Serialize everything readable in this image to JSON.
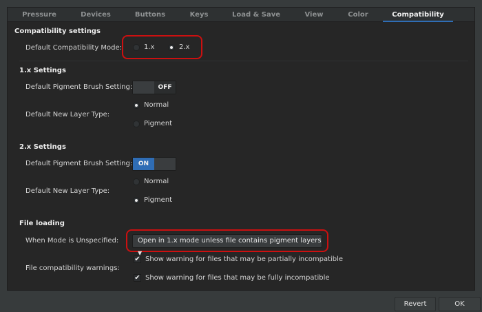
{
  "tabs": [
    {
      "label": "Pressure"
    },
    {
      "label": "Devices"
    },
    {
      "label": "Buttons"
    },
    {
      "label": "Keys"
    },
    {
      "label": "Load & Save"
    },
    {
      "label": "View"
    },
    {
      "label": "Color"
    },
    {
      "label": "Compatibility",
      "active": true
    }
  ],
  "compat": {
    "heading": "Compatibility settings",
    "mode_label": "Default Compatibility Mode:",
    "options": [
      "1.x",
      "2.x"
    ],
    "selected": "2.x"
  },
  "v1": {
    "heading": "1.x Settings",
    "brush_label": "Default Pigment Brush Setting:",
    "brush_state": "OFF",
    "layer_label": "Default New Layer Type:",
    "layer_options": [
      "Normal",
      "Pigment"
    ],
    "layer_selected": "Normal"
  },
  "v2": {
    "heading": "2.x Settings",
    "brush_label": "Default Pigment Brush Setting:",
    "brush_state": "ON",
    "layer_label": "Default New Layer Type:",
    "layer_options": [
      "Normal",
      "Pigment"
    ],
    "layer_selected": "Pigment"
  },
  "file": {
    "heading": "File loading",
    "unspecified_label": "When Mode is Unspecified:",
    "unspecified_value": "Open in 1.x mode unless file contains pigment layers",
    "warnings_label": "File compatibility warnings:",
    "warnings": [
      {
        "label": "Show warning for files that may be partially incompatible",
        "checked": true
      },
      {
        "label": "Show warning for files that may be fully incompatible",
        "checked": true
      }
    ]
  },
  "buttons": {
    "revert": "Revert",
    "ok": "OK"
  },
  "colors": {
    "accent": "#2f6db5",
    "highlight": "#cc1010"
  }
}
